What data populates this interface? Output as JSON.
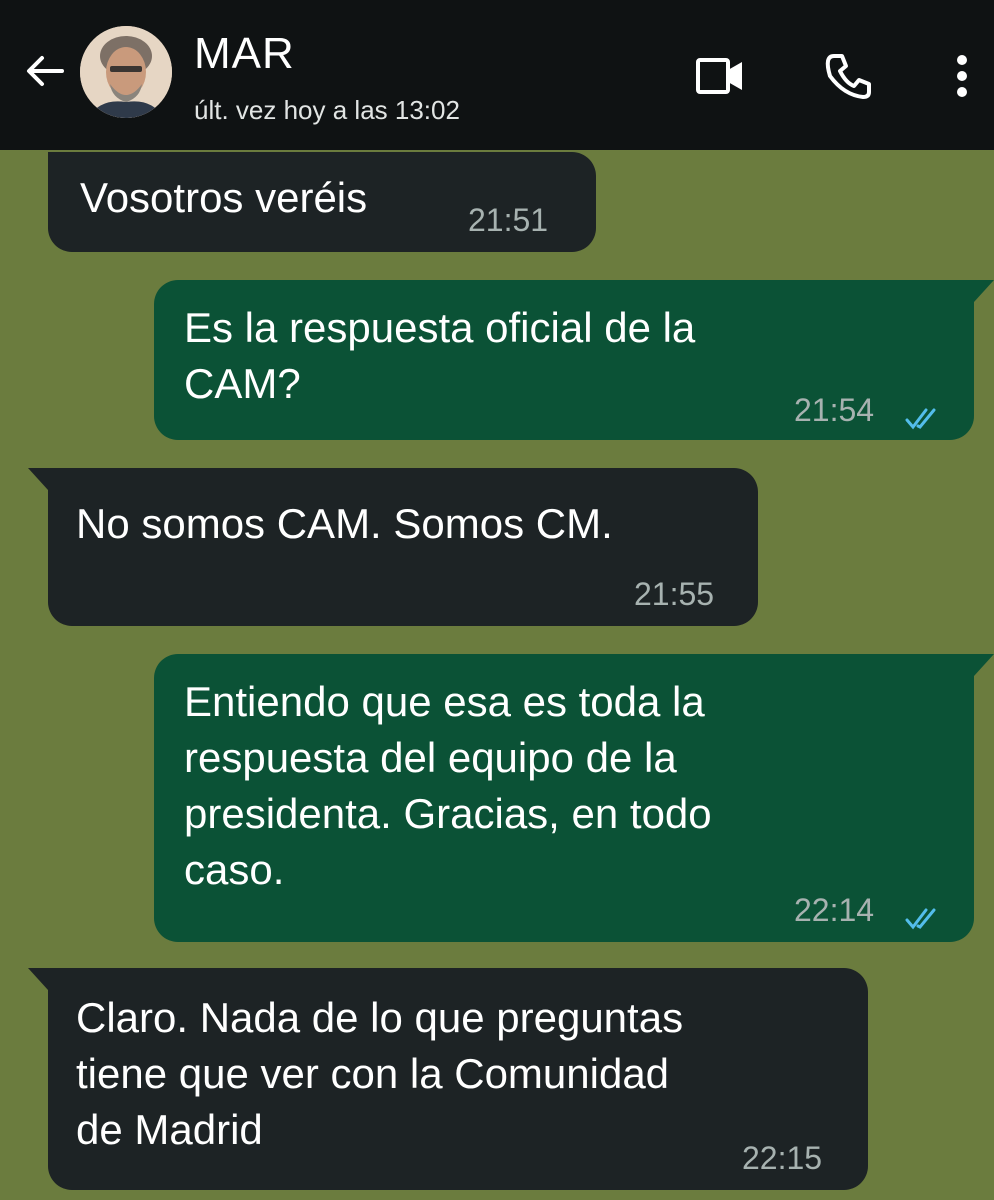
{
  "header": {
    "contact_name": "MAR",
    "last_seen": "últ. vez hoy a las 13:02",
    "icons": [
      "back-arrow-icon",
      "avatar",
      "video-call-icon",
      "phone-icon",
      "more-options-icon"
    ]
  },
  "messages": [
    {
      "direction": "incoming",
      "text": "Vosotros veréis",
      "time": "21:51"
    },
    {
      "direction": "outgoing",
      "text": "Es la respuesta oficial de la\nCAM?",
      "time": "21:54",
      "status": "read"
    },
    {
      "direction": "incoming",
      "text": "No somos CAM. Somos CM.",
      "time": "21:55"
    },
    {
      "direction": "outgoing",
      "text": "Entiendo que esa es toda la\nrespuesta del equipo de la\npresidenta. Gracias, en todo\ncaso.",
      "time": "22:14",
      "status": "read"
    },
    {
      "direction": "incoming",
      "text": "Claro. Nada de lo que preguntas\ntiene que ver con la Comunidad\nde Madrid",
      "time": "22:15"
    }
  ],
  "colors": {
    "chat_background": "#6b7c3e",
    "header_background": "#0f1213",
    "incoming_bubble": "#1d2325",
    "outgoing_bubble": "#0b5236",
    "read_ticks": "#53bdeb"
  }
}
